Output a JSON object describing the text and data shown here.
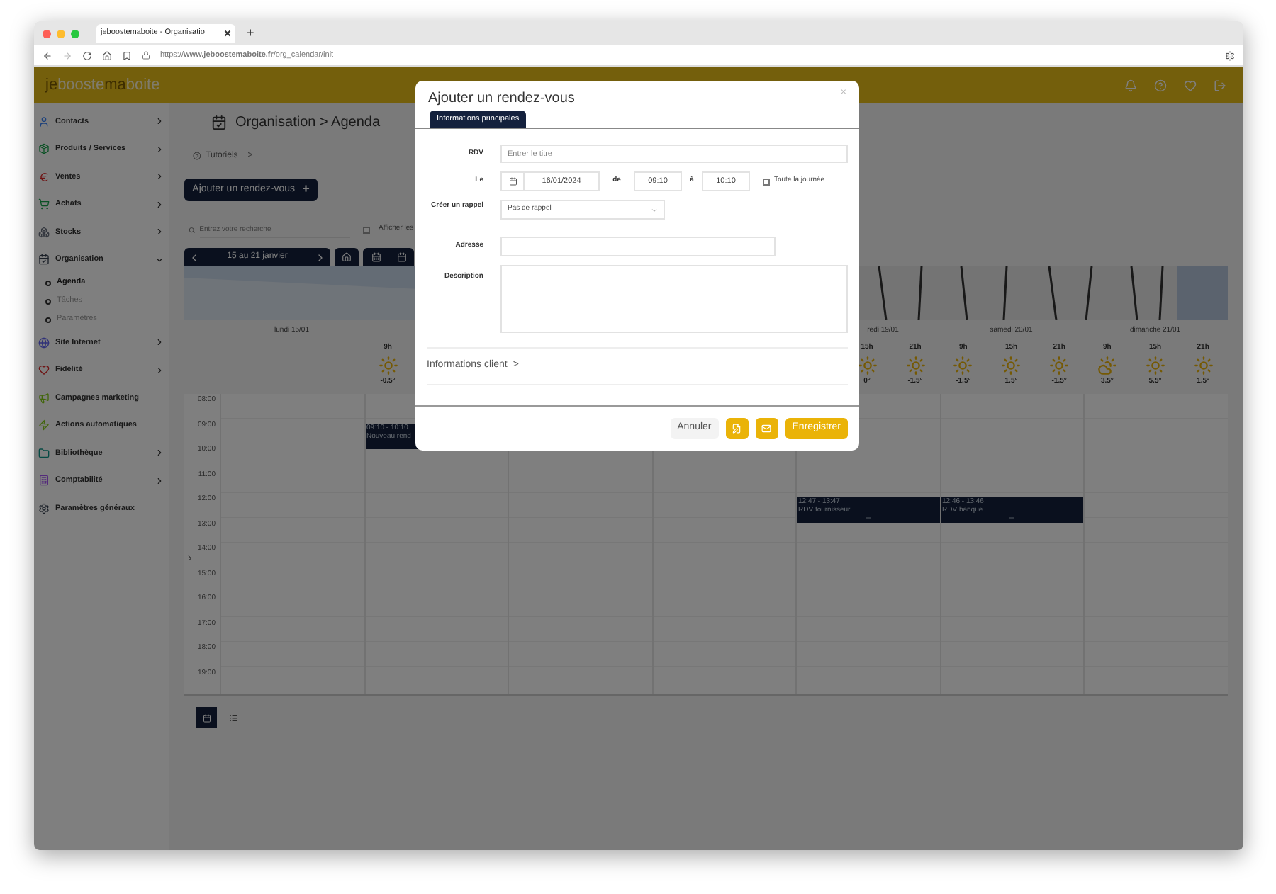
{
  "browser": {
    "tab_title": "jeboostemaboite - Organisatio",
    "new_tab": "+",
    "url": "https://**www.jeboostemaboite.fr**/org_calendar/init"
  },
  "header": {
    "logo": [
      {
        "text": "je",
        "kind": "faint"
      },
      {
        "text": "booste",
        "kind": "strong"
      },
      {
        "text": "ma",
        "kind": "faint"
      },
      {
        "text": "boite",
        "kind": "strong"
      }
    ]
  },
  "sidebar": {
    "items": [
      {
        "label": "Contacts",
        "expanded": false
      },
      {
        "label": "Produits / Services",
        "expanded": false
      },
      {
        "label": "Ventes",
        "expanded": false
      },
      {
        "label": "Achats",
        "expanded": false
      },
      {
        "label": "Stocks",
        "expanded": false
      },
      {
        "label": "Organisation",
        "expanded": true,
        "children": [
          {
            "label": "Agenda",
            "selected": true
          },
          {
            "label": "Tâches",
            "selected": false
          },
          {
            "label": "Paramètres",
            "selected": false
          }
        ]
      },
      {
        "label": "Site Internet",
        "expanded": false
      },
      {
        "label": "Fidélité",
        "expanded": false
      },
      {
        "label": "Campagnes marketing"
      },
      {
        "label": "Actions automatiques"
      },
      {
        "label": "Bibliothèque",
        "expanded": false
      },
      {
        "label": "Comptabilité",
        "expanded": false
      },
      {
        "label": "Paramètres généraux"
      }
    ]
  },
  "main": {
    "title": "Organisation > Agenda",
    "tutorials": "Tutoriels",
    "tutorials_chevron": ">",
    "add_button": "Ajouter un rendez-vous",
    "add_icon": "+",
    "search": {
      "placeholder": "Entrez votre recherche"
    },
    "show_checkbox": {
      "label": "Afficher les",
      "checked": false
    },
    "week_label": "15 au 21 janvier"
  },
  "calendar": {
    "days": [
      {
        "label": "lundi 15/01"
      },
      {
        "slots": [
          {
            "hour": "9h",
            "temp": "-0.5°",
            "kind": "sun"
          }
        ]
      },
      {
        "label": "redi 19/01",
        "slots": [
          {
            "hour": "15h",
            "temp": "0°",
            "kind": "sun"
          },
          {
            "hour": "21h",
            "temp": "-1.5°",
            "kind": "sun"
          }
        ]
      },
      {
        "label": "samedi 20/01",
        "slots": [
          {
            "hour": "9h",
            "temp": "-1.5°",
            "kind": "sun"
          },
          {
            "hour": "15h",
            "temp": "1.5°",
            "kind": "sun"
          },
          {
            "hour": "21h",
            "temp": "-1.5°",
            "kind": "sun"
          }
        ]
      },
      {
        "label": "dimanche 21/01",
        "slots": [
          {
            "hour": "9h",
            "temp": "3.5°",
            "kind": "cloud"
          },
          {
            "hour": "15h",
            "temp": "5.5°",
            "kind": "sun"
          },
          {
            "hour": "21h",
            "temp": "1.5°",
            "kind": "sun"
          }
        ]
      }
    ],
    "hours": [
      "08:00",
      "09:00",
      "10:00",
      "11:00",
      "12:00",
      "13:00",
      "14:00",
      "15:00",
      "16:00",
      "17:00",
      "18:00",
      "19:00"
    ],
    "events": [
      {
        "time": "09:10 - 10:10",
        "title": "Nouveau rend"
      },
      {
        "time": "12:47 - 13:47",
        "title": "RDV fournisseur"
      },
      {
        "time": "12:46 - 13:46",
        "title": "RDV banque"
      }
    ],
    "views": [
      {
        "kind": "calendar",
        "selected": true
      },
      {
        "kind": "list",
        "selected": false
      }
    ]
  },
  "modal": {
    "title": "Ajouter un rendez-vous",
    "close": "×",
    "tabs": [
      {
        "label": "Informations principales",
        "selected": true
      }
    ],
    "fields": {
      "rdv_label": "RDV",
      "rdv_placeholder": "Entrer le titre",
      "date_label": "Le",
      "date": "16/01/2024",
      "from_label": "de",
      "from": "09:10",
      "to_label": "à",
      "to": "10:10",
      "all_day": {
        "label": "Toute la journée",
        "checked": false
      },
      "reminder_label": "Créer un rappel",
      "reminder": "Pas de rappel",
      "address_label": "Adresse",
      "description_label": "Description"
    },
    "client_section": "Informations client",
    "client_chevron": ">",
    "buttons": {
      "cancel": "Annuler",
      "save": "Enregistrer"
    }
  }
}
